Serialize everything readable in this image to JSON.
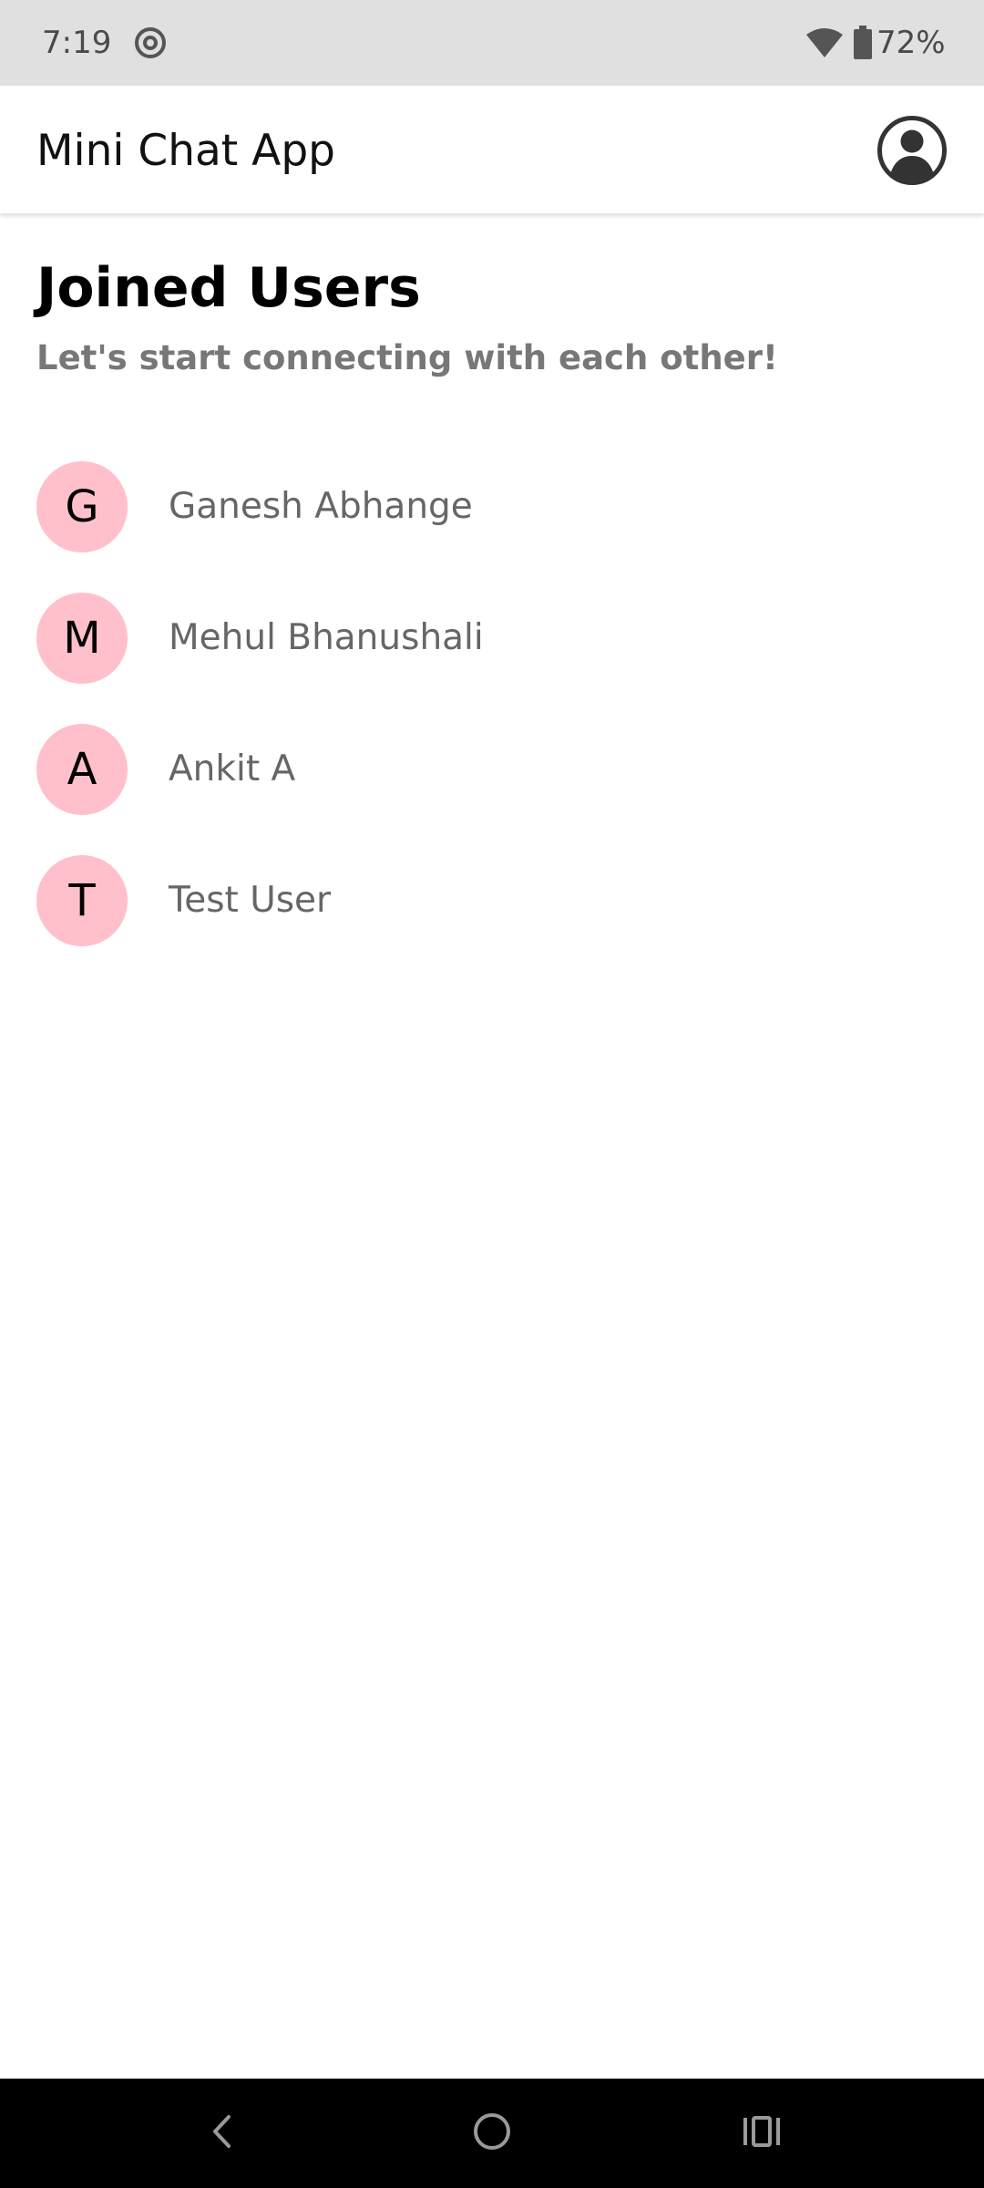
{
  "status_bar": {
    "time": "7:19",
    "battery": "72%",
    "icons": [
      "cast-icon",
      "wifi-icon",
      "battery-icon"
    ]
  },
  "app_bar": {
    "title": "Mini Chat App",
    "profile_icon": "account-circle-icon"
  },
  "main": {
    "title": "Joined Users",
    "subtitle": "Let's start connecting with each other!",
    "users": [
      {
        "initial": "G",
        "name": "Ganesh Abhange"
      },
      {
        "initial": "M",
        "name": "Mehul Bhanushali"
      },
      {
        "initial": "A",
        "name": "Ankit A"
      },
      {
        "initial": "T",
        "name": "Test User"
      }
    ]
  },
  "nav_bar": {
    "icons": [
      "back-icon",
      "home-icon",
      "recents-icon"
    ]
  },
  "colors": {
    "avatar_bg": "#ffc0cb",
    "status_bar_bg": "#e0e0e0",
    "nav_bar_bg": "#000000",
    "subtitle": "#777777",
    "user_name": "#666666"
  }
}
